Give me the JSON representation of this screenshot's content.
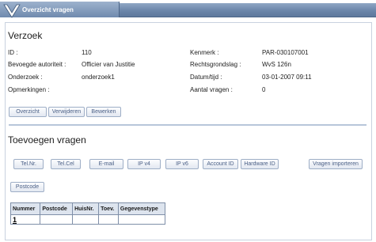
{
  "window": {
    "title": "Overzicht vragen"
  },
  "verzoek": {
    "heading": "Verzoek",
    "left": [
      {
        "label": "ID :",
        "value": "110"
      },
      {
        "label": "Bevoegde autoriteit :",
        "value": "Officier van Justitie"
      },
      {
        "label": "Onderzoek :",
        "value": "onderzoek1"
      },
      {
        "label": "Opmerkingen :",
        "value": ""
      }
    ],
    "right": [
      {
        "label": "Kenmerk :",
        "value": "PAR-030107001"
      },
      {
        "label": "Rechtsgrondslag :",
        "value": "WvS 126n"
      },
      {
        "label": "Datum/tijd :",
        "value": "03-01-2007 09:11"
      },
      {
        "label": "Aantal vragen :",
        "value": "0"
      }
    ],
    "buttons": {
      "overzicht": "Overzicht",
      "verwijderen": "Verwijderen",
      "bewerken": "Bewerken"
    }
  },
  "toevoegen": {
    "heading": "Toevoegen vragen",
    "buttons": {
      "telnr": "Tel.Nr.",
      "telcel": "Tel.Cel",
      "email": "E-mail",
      "ipv4": "IP v4",
      "ipv6": "IP v6",
      "accountid": "Account ID",
      "hardwareid": "Hardware ID",
      "importeren": "Vragen importeren",
      "postcode": "Postcode"
    },
    "table": {
      "columns": [
        "Nummer",
        "Postcode",
        "HuisNr.",
        "Toev.",
        "Gegevenstype"
      ],
      "rows": [
        [
          "1",
          "",
          "",
          "",
          ""
        ]
      ]
    }
  },
  "colors": {
    "titlebar": "#6b86aa",
    "button_text": "#4a5f86",
    "separator": "#b8c6da"
  }
}
